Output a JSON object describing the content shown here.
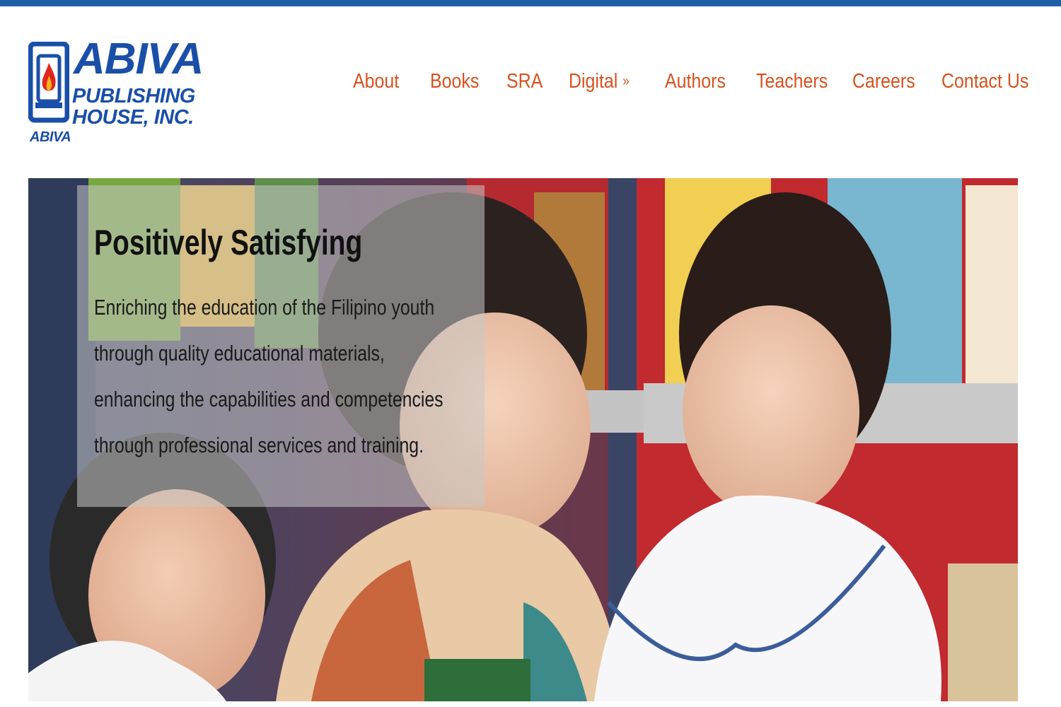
{
  "logo": {
    "name": "ABIVA",
    "line1": "PUBLISHING",
    "line2": "HOUSE, INC.",
    "small": "ABIVA",
    "brand_color": "#1a4fa8",
    "flame_color": "#e2261b"
  },
  "nav": {
    "items": [
      {
        "label": "About"
      },
      {
        "label": "Books"
      },
      {
        "label": "SRA"
      },
      {
        "label": "Digital",
        "has_dropdown": true,
        "icon": "chevron-double-down-icon"
      },
      {
        "label": "Authors"
      },
      {
        "label": "Teachers"
      },
      {
        "label": "Careers"
      },
      {
        "label": "Contact Us"
      }
    ],
    "color": "#d6521e"
  },
  "hero": {
    "title": "Positively Satisfying",
    "text": "Enriching the education of the Filipino youth through quality educational materials, enhancing the capabilities and competencies through professional services and training."
  },
  "colors": {
    "top_bar": "#1f5fa6"
  }
}
